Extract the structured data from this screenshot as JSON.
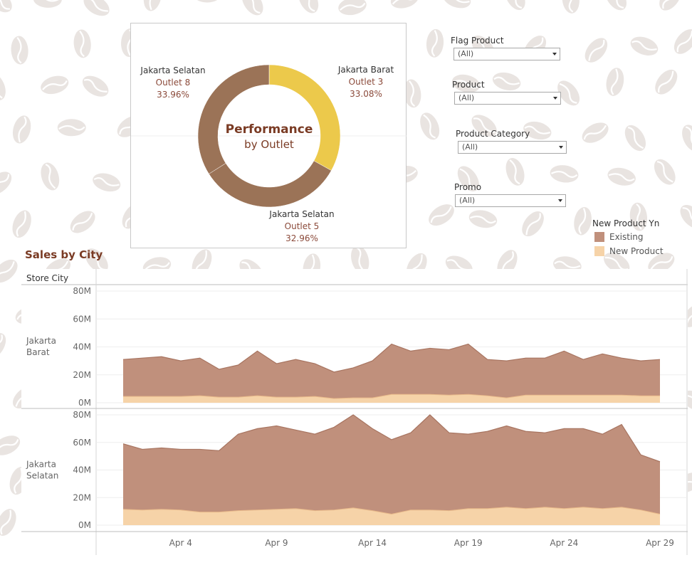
{
  "donut": {
    "center_title": "Performance",
    "center_subtitle": "by Outlet",
    "colors": {
      "outlet3": "#ecc94b",
      "outlet5": "#9b7357",
      "outlet8": "#9b7357"
    },
    "slices": [
      {
        "city": "Jakarta Barat",
        "outlet": "Outlet  3",
        "percent": "33.08%",
        "value": 33.08
      },
      {
        "city": "Jakarta Selatan",
        "outlet": "Outlet  5",
        "percent": "32.96%",
        "value": 32.96
      },
      {
        "city": "Jakarta Selatan",
        "outlet": "Outlet  8",
        "percent": "33.96%",
        "value": 33.96
      }
    ]
  },
  "filters": [
    {
      "label": "Flag  Product",
      "value": "(All)"
    },
    {
      "label": "Product",
      "value": "(All)"
    },
    {
      "label": "Product Category",
      "value": "(All)"
    },
    {
      "label": "Promo",
      "value": "(All)"
    }
  ],
  "legend": {
    "title": "New Product Yn",
    "items": [
      {
        "label": "Existing",
        "color": "#c0907c"
      },
      {
        "label": "New Product",
        "color": "#f6d3a8"
      }
    ]
  },
  "sales_title": "Sales by City",
  "chart_data": {
    "type": "area",
    "row_header": "Store City",
    "x_ticks": [
      "Apr 4",
      "Apr 9",
      "Apr 14",
      "Apr 19",
      "Apr 24",
      "Apr 29"
    ],
    "x_tick_days": [
      4,
      9,
      14,
      19,
      24,
      29
    ],
    "x_days": [
      1,
      2,
      3,
      4,
      5,
      6,
      7,
      8,
      9,
      10,
      11,
      12,
      13,
      14,
      15,
      16,
      17,
      18,
      19,
      20,
      21,
      22,
      23,
      24,
      25,
      26,
      27,
      28,
      29
    ],
    "ylim": [
      0,
      80
    ],
    "y_ticks": [
      "0M",
      "20M",
      "40M",
      "60M",
      "80M"
    ],
    "y_tick_values": [
      0,
      20,
      40,
      60,
      80
    ],
    "colors": {
      "existing": "#c0907c",
      "existing_line": "#a87561",
      "new": "#f6d3a8",
      "new_line": "#e8b98a"
    },
    "panes": [
      {
        "label_line1": "Jakarta",
        "label_line2": "Barat",
        "existing_total": [
          31,
          32,
          33,
          30,
          32,
          24,
          27,
          37,
          28,
          31,
          28,
          22,
          25,
          30,
          42,
          37,
          39,
          38,
          42,
          31,
          30,
          32,
          32,
          37,
          31,
          35,
          32,
          30,
          31
        ],
        "new_product": [
          4.5,
          4.5,
          4.5,
          4.5,
          5,
          4,
          4,
          5,
          4,
          4,
          4.5,
          3,
          3.5,
          3.5,
          6,
          6,
          6,
          5.5,
          6,
          5,
          3.5,
          5.5,
          5.5,
          5.5,
          5.5,
          5.5,
          5.5,
          5,
          5
        ]
      },
      {
        "label_line1": "Jakarta",
        "label_line2": "Selatan",
        "existing_total": [
          59,
          55,
          56,
          55,
          55,
          54,
          66,
          70,
          72,
          69,
          66,
          71,
          80,
          70,
          62,
          67,
          80,
          67,
          66,
          68,
          72,
          68,
          67,
          70,
          70,
          66,
          73,
          51,
          46
        ],
        "new_product": [
          11.5,
          11,
          11.5,
          11,
          9.5,
          9.5,
          10.5,
          11,
          11.5,
          12,
          10.5,
          11,
          12.5,
          10.5,
          8,
          11,
          11,
          10.5,
          12,
          12,
          13,
          12,
          13,
          12,
          13,
          12,
          13,
          11,
          8
        ]
      }
    ]
  }
}
